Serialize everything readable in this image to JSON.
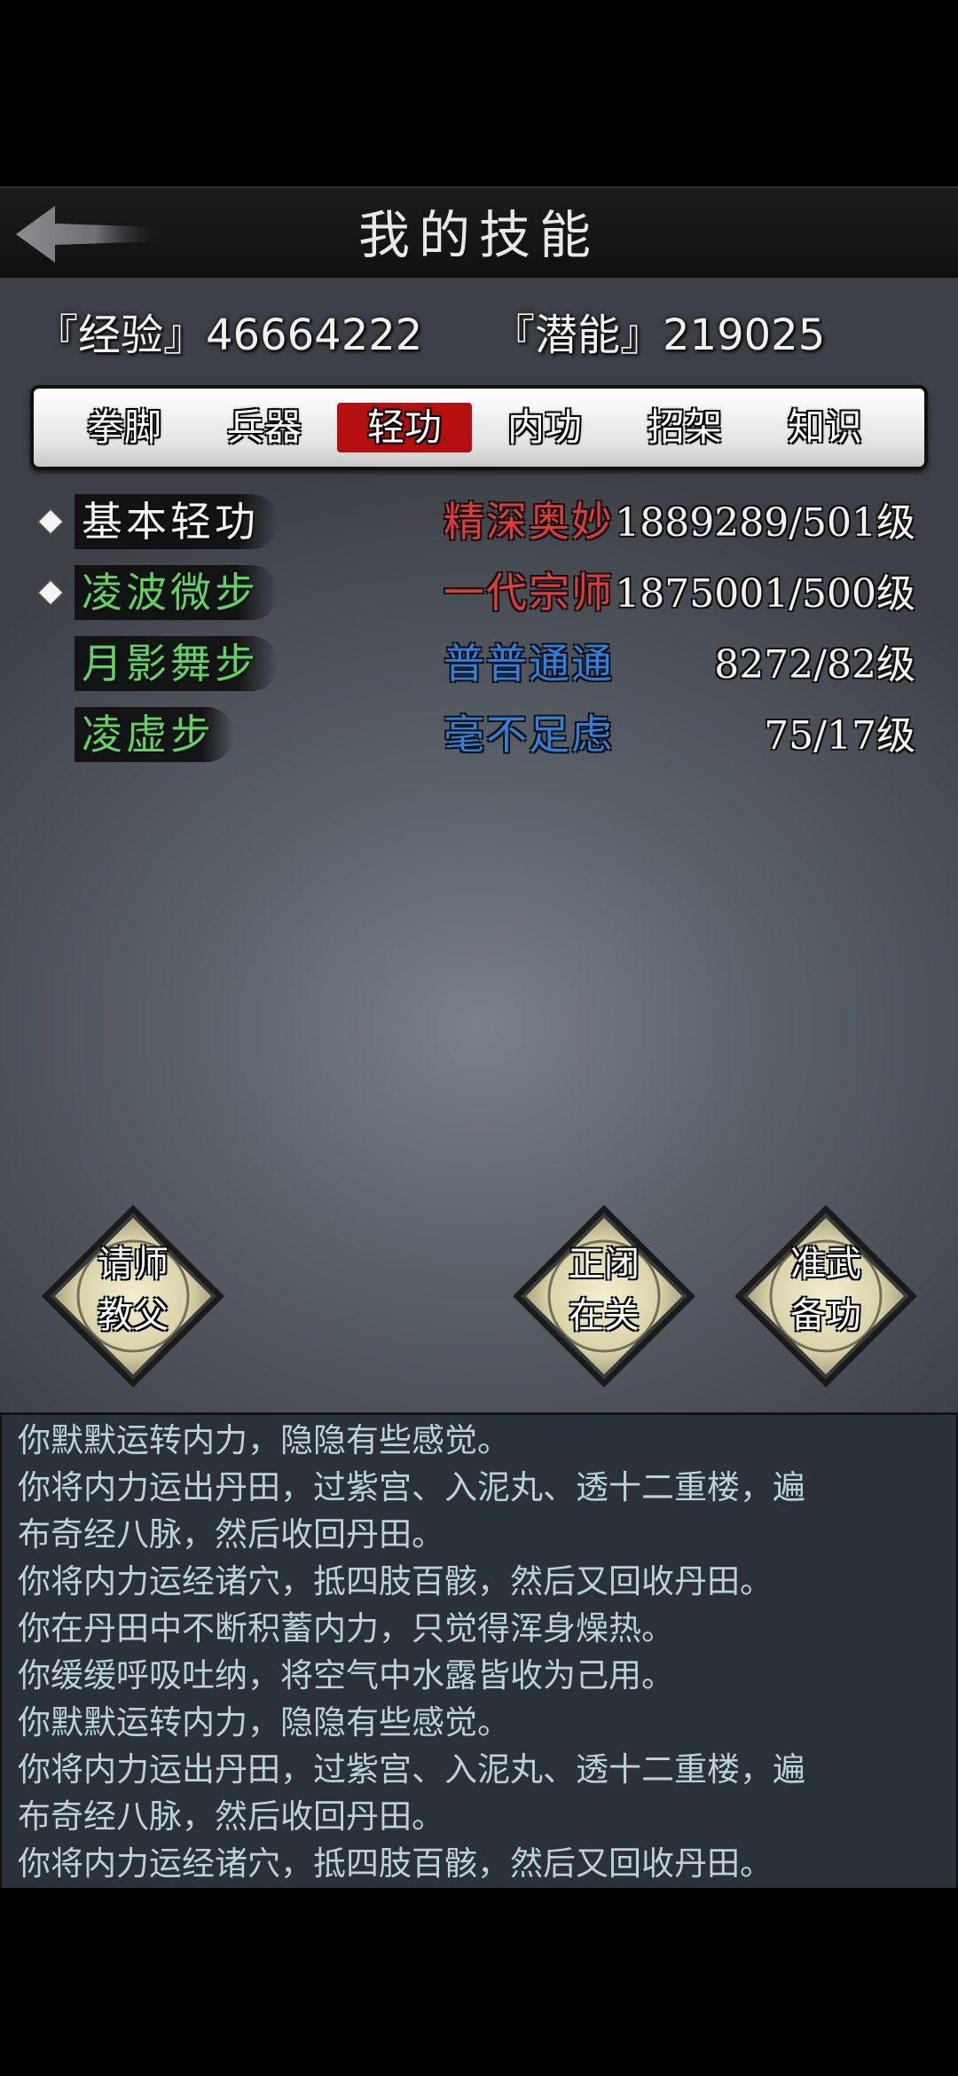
{
  "header": {
    "title": "我的技能",
    "back_icon": "arrow-left-icon"
  },
  "stats": {
    "experience": "『经验』46664222",
    "potential": "『潜能』219025"
  },
  "tabs": [
    {
      "label": "拳脚",
      "active": false
    },
    {
      "label": "兵器",
      "active": false
    },
    {
      "label": "轻功",
      "active": true
    },
    {
      "label": "内功",
      "active": false
    },
    {
      "label": "招架",
      "active": false
    },
    {
      "label": "知识",
      "active": false
    }
  ],
  "skills": [
    {
      "name": "基本轻功",
      "rank": "精深奥妙",
      "level": "1889289/501级",
      "marked": true,
      "name_color": "#f5f5f5",
      "rank_color": "#e23a3a"
    },
    {
      "name": "凌波微步",
      "rank": "一代宗师",
      "level": "1875001/500级",
      "marked": true,
      "name_color": "#5fd45f",
      "rank_color": "#e23a3a"
    },
    {
      "name": "月影舞步",
      "rank": "普普通通",
      "level": "8272/82级",
      "marked": false,
      "name_color": "#5fd45f",
      "rank_color": "#2f7fe0"
    },
    {
      "name": "凌虚步",
      "rank": "毫不足虑",
      "level": "75/17级",
      "marked": false,
      "name_color": "#5fd45f",
      "rank_color": "#2f7fe0"
    }
  ],
  "actions": [
    {
      "line1": "请师",
      "line2": "教父"
    },
    {
      "line1": "正闭",
      "line2": "在关"
    },
    {
      "line1": "准武",
      "line2": "备功"
    }
  ],
  "log": [
    "你默默运转内力，隐隐有些感觉。",
    "你将内力运出丹田，过紫宫、入泥丸、透十二重楼，遍",
    "布奇经八脉，然后收回丹田。",
    "你将内力运经诸穴，抵四肢百骸，然后又回收丹田。",
    "你在丹田中不断积蓄内力，只觉得浑身燥热。",
    "你缓缓呼吸吐纳，将空气中水露皆收为己用。",
    "你默默运转内力，隐隐有些感觉。",
    "你将内力运出丹田，过紫宫、入泥丸、透十二重楼，遍",
    "布奇经八脉，然后收回丹田。",
    "你将内力运经诸穴，抵四肢百骸，然后又回收丹田。"
  ],
  "colors": {
    "active_tab": "#b50f0f",
    "log_text": "#bcd2d6",
    "log_bg": "#2a3139"
  }
}
